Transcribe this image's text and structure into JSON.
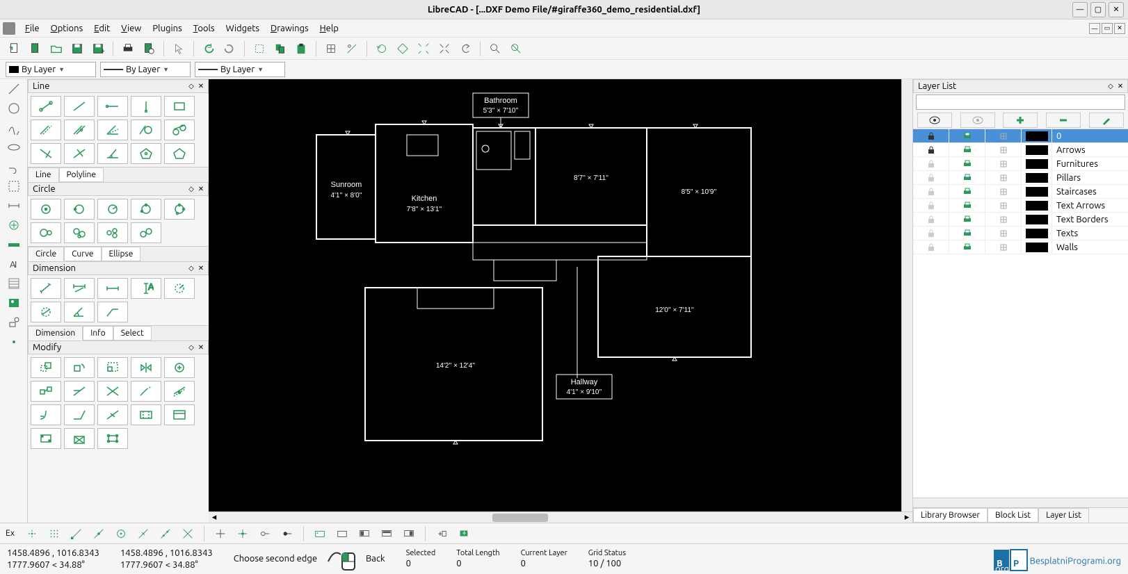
{
  "window": {
    "title": "LibreCAD - [...DXF Demo File/#giraffe360_demo_residential.dxf]"
  },
  "menu": {
    "items": [
      "File",
      "Options",
      "Edit",
      "View",
      "Plugins",
      "Tools",
      "Widgets",
      "Drawings",
      "Help"
    ]
  },
  "combos": {
    "color": "By Layer",
    "linewidth": "By Layer",
    "linetype": "By Layer"
  },
  "panels": {
    "line": {
      "title": "Line",
      "tabs": [
        "Line",
        "Polyline"
      ],
      "active": 0
    },
    "circle": {
      "title": "Circle",
      "tabs": [
        "Circle",
        "Curve",
        "Ellipse"
      ],
      "active": 0
    },
    "dimension": {
      "title": "Dimension",
      "tabs": [
        "Dimension",
        "Info",
        "Select"
      ],
      "active": 0
    },
    "modify": {
      "title": "Modify"
    }
  },
  "layer_panel": {
    "title": "Layer List",
    "tabs": [
      "Library Browser",
      "Block List",
      "Layer List"
    ],
    "active": 2,
    "layers": [
      {
        "name": "0",
        "locked": true,
        "color": "#000",
        "selected": true
      },
      {
        "name": "Arrows",
        "locked": true,
        "color": "#000"
      },
      {
        "name": "Furnitures",
        "locked": false,
        "color": "#000"
      },
      {
        "name": "Pillars",
        "locked": false,
        "color": "#000"
      },
      {
        "name": "Staircases",
        "locked": false,
        "color": "#000"
      },
      {
        "name": "Text Arrows",
        "locked": false,
        "color": "#000"
      },
      {
        "name": "Text Borders",
        "locked": false,
        "color": "#000"
      },
      {
        "name": "Texts",
        "locked": false,
        "color": "#000"
      },
      {
        "name": "Walls",
        "locked": false,
        "color": "#000"
      }
    ]
  },
  "status": {
    "coords1": "1458.4896 , 1016.8343",
    "angle1": "1777.9607 < 34.88°",
    "coords2": "1458.4896 , 1016.8343",
    "angle2": "1777.9607 < 34.88°",
    "hint": "Choose second edge",
    "back": "Back",
    "selected_label": "Selected",
    "selected_val": "0",
    "totlen_label": "Total Length",
    "totlen_val": "0",
    "curlayer_label": "Current Layer",
    "curlayer_val": "0",
    "grid_label": "Grid Status",
    "grid_val": "10 / 100"
  },
  "bottombar": {
    "ex": "Ex"
  },
  "floorplan": {
    "rooms": [
      {
        "name": "Bathroom",
        "dim": "5'3'' × 7'10''",
        "boxed": true
      },
      {
        "name": "Sunroom",
        "dim": "4'1'' × 8'0''"
      },
      {
        "name": "Kitchen",
        "dim": "7'8'' × 13'1''"
      },
      {
        "name": "",
        "dim": "8'7'' × 7'11''"
      },
      {
        "name": "",
        "dim": "8'5'' × 10'9''"
      },
      {
        "name": "",
        "dim": "12'0'' × 7'11''"
      },
      {
        "name": "",
        "dim": "14'2'' × 12'4''"
      },
      {
        "name": "Hallway",
        "dim": "4'1'' × 9'10''",
        "boxed": true
      }
    ]
  },
  "logo": "BesplatniProgrami.org"
}
